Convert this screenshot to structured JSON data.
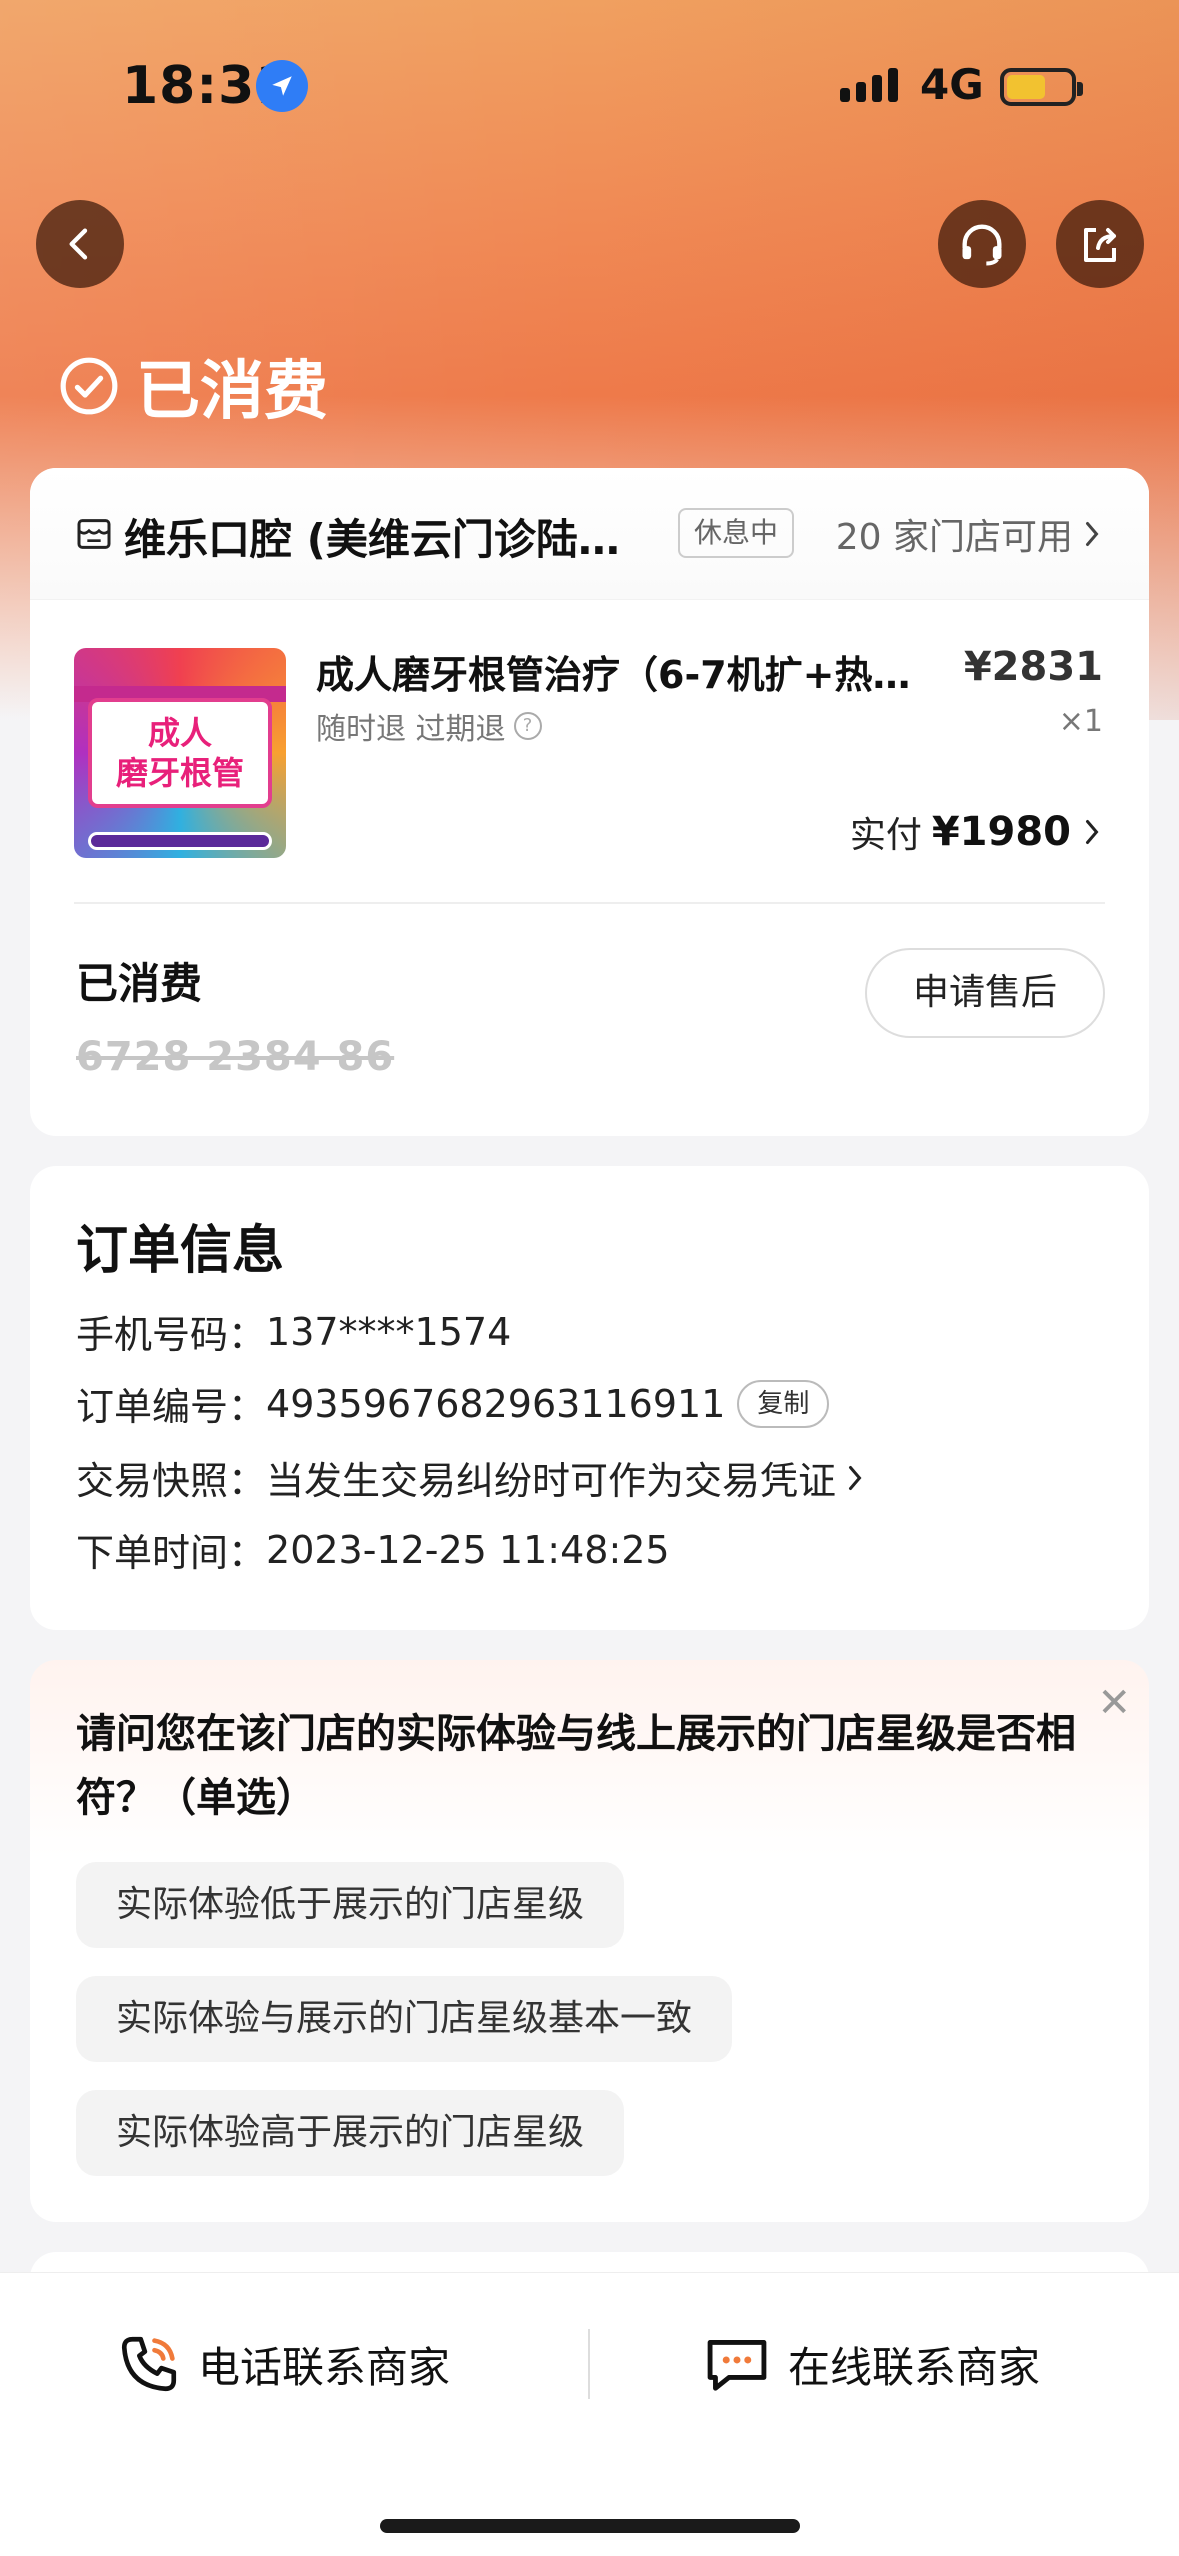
{
  "status_bar": {
    "time": "18:31",
    "network": "4G",
    "battery_level": 0.62
  },
  "header": {
    "state_label": "已消费"
  },
  "store": {
    "name": "维乐口腔 (美维云门诊陆…",
    "status_badge": "休息中",
    "stores_available": "20 家门店可用"
  },
  "product": {
    "image_text_line1": "成人",
    "image_text_line2": "磨牙根管",
    "title": "成人磨牙根管治疗（6-7机扩+热…",
    "price": "¥2831",
    "tags": "随时退 过期退",
    "quantity": "×1",
    "paid_label": "实付",
    "paid_value": "¥1980"
  },
  "voucher": {
    "title": "已消费",
    "code": "6728 2384 86",
    "after_sale_label": "申请售后"
  },
  "order_info": {
    "title": "订单信息",
    "phone_label": "手机号码：",
    "phone_value": "137****1574",
    "order_no_label": "订单编号：",
    "order_no_value": "4935967682963116911",
    "copy_label": "复制",
    "snapshot_label": "交易快照：",
    "snapshot_value": "当发生交易纠纷时可作为交易凭证",
    "time_label": "下单时间：",
    "time_value": "2023-12-25 11:48:25"
  },
  "survey": {
    "question": "请问您在该门店的实际体验与线上展示的门店星级是否相符？（单选）",
    "options": [
      "实际体验低于展示的门店星级",
      "实际体验与展示的门店星级基本一致",
      "实际体验高于展示的门店星级"
    ]
  },
  "bottom_bar": {
    "phone_contact": "电话联系商家",
    "online_contact": "在线联系商家"
  },
  "colors": {
    "hero_orange": "#ee7a4a",
    "accent_blue": "#2f7df6"
  }
}
